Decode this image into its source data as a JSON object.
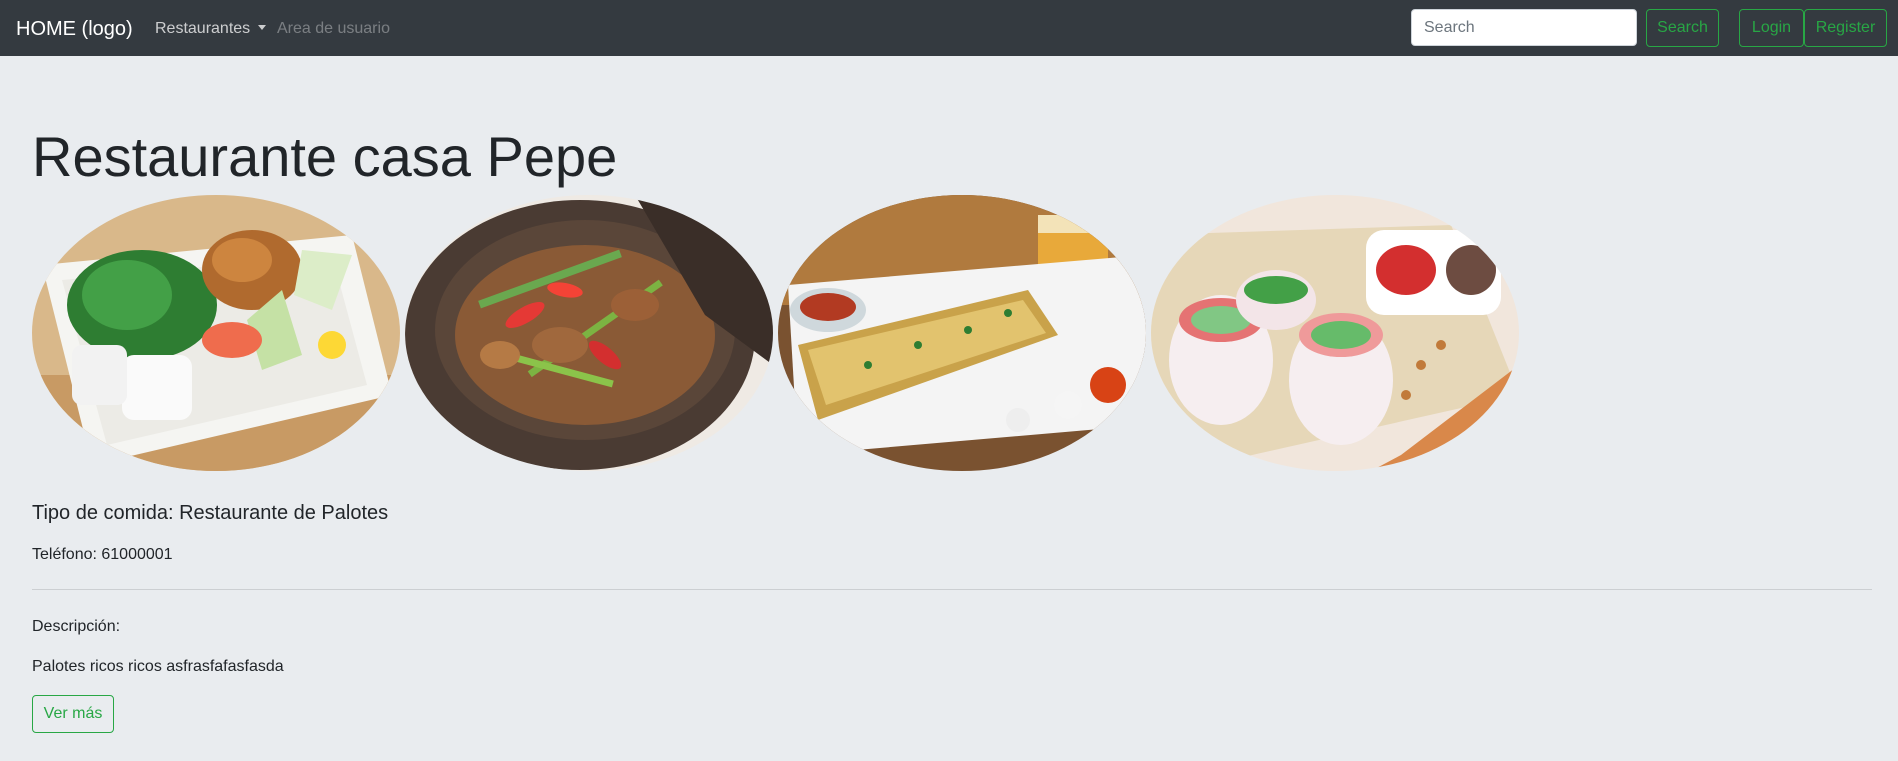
{
  "navbar": {
    "brand": "HOME (logo)",
    "restaurantes": "Restaurantes",
    "area_usuario": "Area de usuario",
    "search_placeholder": "Search",
    "search_button": "Search",
    "login_button": "Login",
    "register_button": "Register"
  },
  "restaurant": {
    "name": "Restaurante casa Pepe",
    "food_type": "Tipo de comida: Restaurante de Palotes",
    "phone": "Teléfono: 61000001",
    "description_label": "Descripción:",
    "description": "Palotes ricos ricos asfrasfafasfasda",
    "more_button": "Ver más"
  },
  "photos": [
    {
      "icon": "sushi-bento-photo"
    },
    {
      "icon": "stir-fry-pot-photo"
    },
    {
      "icon": "flatbread-pizza-photo"
    },
    {
      "icon": "spring-rolls-photo"
    }
  ],
  "colors": {
    "navbar_bg": "#343a40",
    "page_bg": "#e9ecef",
    "accent_green": "#28a745"
  }
}
